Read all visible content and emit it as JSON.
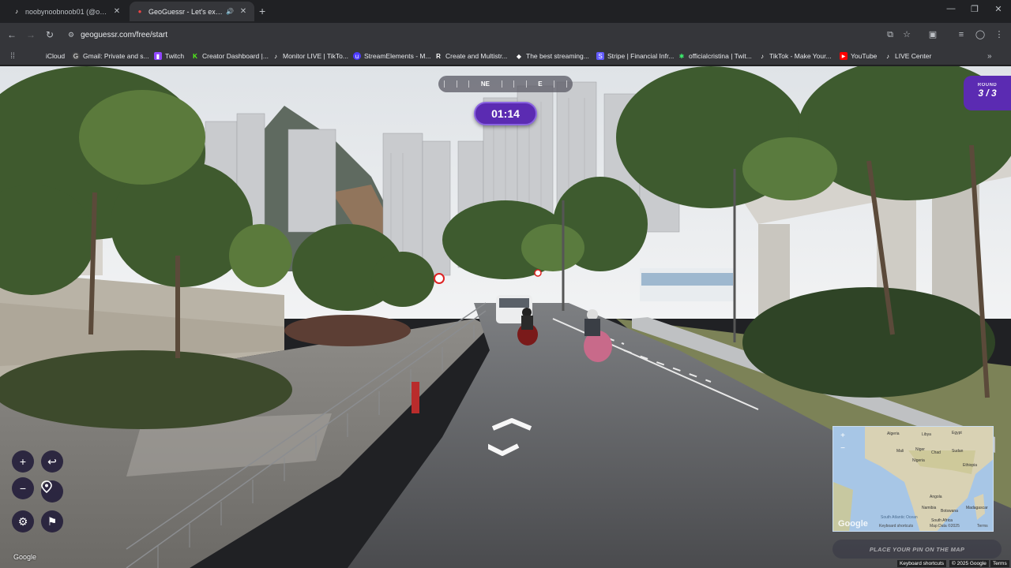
{
  "browser": {
    "tabs": [
      {
        "title": "noobynoobnoob01 (@officialc...",
        "icon": "tiktok-icon",
        "active": false
      },
      {
        "title": "GeoGuessr - Let's explore th...",
        "icon": "geoguessr-pin-icon",
        "active": true
      }
    ],
    "url": "geoguessr.com/free/start",
    "bookmarks": [
      {
        "label": "iCloud",
        "icon": "apple-icon"
      },
      {
        "label": "Gmail: Private and s...",
        "icon": "google-icon"
      },
      {
        "label": "Twitch",
        "icon": "twitch-icon"
      },
      {
        "label": "Creator Dashboard |...",
        "icon": "kick-icon"
      },
      {
        "label": "Monitor LIVE | TikTo...",
        "icon": "tiktok-icon"
      },
      {
        "label": "StreamElements - M...",
        "icon": "streamelements-icon"
      },
      {
        "label": "Create and Multistr...",
        "icon": "restream-icon"
      },
      {
        "label": "The best streaming...",
        "icon": "diamond-icon"
      },
      {
        "label": "Stripe | Financial Infr...",
        "icon": "stripe-icon"
      },
      {
        "label": "officialcristina | Twit...",
        "icon": "twitch-star-icon"
      },
      {
        "label": "TikTok - Make Your...",
        "icon": "tiktok-icon"
      },
      {
        "label": "YouTube",
        "icon": "youtube-icon"
      },
      {
        "label": "LIVE Center",
        "icon": "tiktok-icon"
      }
    ]
  },
  "game": {
    "compass": {
      "left": "NE",
      "right": "E"
    },
    "timer": "01:14",
    "round": {
      "label": "ROUND",
      "value": "3 / 3"
    },
    "controls": {
      "zoom_in": "+",
      "zoom_out": "−",
      "undo": "↩",
      "settings": "⚙",
      "flag": "⚑"
    },
    "minimap": {
      "labels": [
        "Algeria",
        "Libya",
        "Egypt",
        "Mali",
        "Niger",
        "Chad",
        "Sudan",
        "Nigeria",
        "Ethiopia",
        "Angola",
        "Namibia",
        "Botswana",
        "South Africa",
        "Madagascar",
        "South Atlantic Ocean"
      ],
      "google": "Google",
      "footer": {
        "shortcuts": "Keyboard shortcuts",
        "data": "Map Data ©2025",
        "terms": "Terms"
      }
    },
    "place_pin_label": "PLACE YOUR PIN ON THE MAP",
    "streetview_google": "Google",
    "streetview_footer": {
      "shortcuts": "Keyboard shortcuts",
      "copyright": "© 2025 Google",
      "terms": "Terms"
    }
  },
  "colors": {
    "accent": "#5b2bb2",
    "chrome_dark": "#202124",
    "chrome_mid": "#35363a"
  }
}
